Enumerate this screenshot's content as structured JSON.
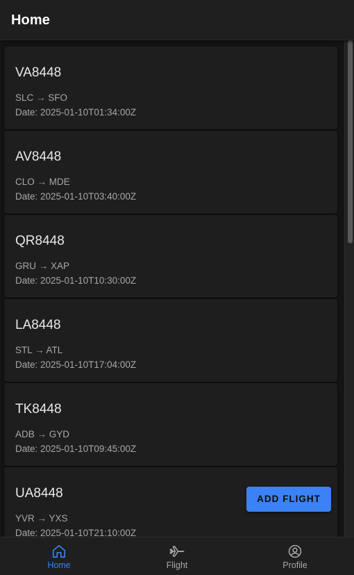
{
  "app_bar": {
    "title": "Home"
  },
  "flights": [
    {
      "code": "VA8448",
      "route": "SLC → SFO",
      "date": "Date: 2025-01-10T01:34:00Z"
    },
    {
      "code": "AV8448",
      "route": "CLO → MDE",
      "date": "Date: 2025-01-10T03:40:00Z"
    },
    {
      "code": "QR8448",
      "route": "GRU → XAP",
      "date": "Date: 2025-01-10T10:30:00Z"
    },
    {
      "code": "LA8448",
      "route": "STL → ATL",
      "date": "Date: 2025-01-10T17:04:00Z"
    },
    {
      "code": "TK8448",
      "route": "ADB → GYD",
      "date": "Date: 2025-01-10T09:45:00Z"
    },
    {
      "code": "UA8448",
      "route": "YVR → YXS",
      "date": "Date: 2025-01-10T21:10:00Z"
    }
  ],
  "fab": {
    "label": "ADD FLIGHT"
  },
  "bottom_nav": {
    "items": [
      {
        "label": "Home",
        "icon": "home-icon",
        "active": true
      },
      {
        "label": "Flight",
        "icon": "airplane-icon",
        "active": false
      },
      {
        "label": "Profile",
        "icon": "account-circle-icon",
        "active": false
      }
    ]
  },
  "colors": {
    "accent": "#3b82f6",
    "background": "#141414",
    "surface": "#1e1e1e",
    "app_bar": "#1f1f1f"
  }
}
